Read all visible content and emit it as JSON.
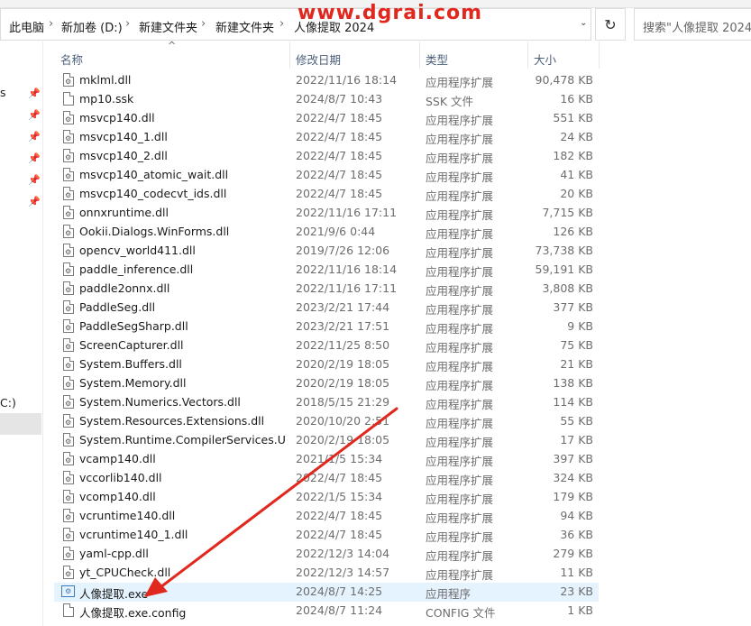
{
  "address_bar": {
    "crumbs": [
      "此电脑",
      "新加卷 (D:)",
      "新建文件夹",
      "新建文件夹",
      "人像提取 2024"
    ],
    "refresh_icon": "refresh-icon"
  },
  "search": {
    "placeholder": "搜索\"人像提取 2024\""
  },
  "watermark": "www.dgrai.com",
  "nav": {
    "partial_label_1": "s",
    "partial_label_2": "C:)"
  },
  "columns": {
    "name": "名称",
    "date": "修改日期",
    "type": "类型",
    "size": "大小"
  },
  "files": [
    {
      "name": "mklml.dll",
      "date": "2022/11/16 18:14",
      "type": "应用程序扩展",
      "size": "90,478 KB",
      "icon": "dll-file-icon"
    },
    {
      "name": "mp10.ssk",
      "date": "2024/8/7 10:43",
      "type": "SSK 文件",
      "size": "16 KB",
      "icon": "file-icon"
    },
    {
      "name": "msvcp140.dll",
      "date": "2022/4/7 18:45",
      "type": "应用程序扩展",
      "size": "551 KB",
      "icon": "dll-file-icon"
    },
    {
      "name": "msvcp140_1.dll",
      "date": "2022/4/7 18:45",
      "type": "应用程序扩展",
      "size": "24 KB",
      "icon": "dll-file-icon"
    },
    {
      "name": "msvcp140_2.dll",
      "date": "2022/4/7 18:45",
      "type": "应用程序扩展",
      "size": "182 KB",
      "icon": "dll-file-icon"
    },
    {
      "name": "msvcp140_atomic_wait.dll",
      "date": "2022/4/7 18:45",
      "type": "应用程序扩展",
      "size": "41 KB",
      "icon": "dll-file-icon"
    },
    {
      "name": "msvcp140_codecvt_ids.dll",
      "date": "2022/4/7 18:45",
      "type": "应用程序扩展",
      "size": "20 KB",
      "icon": "dll-file-icon"
    },
    {
      "name": "onnxruntime.dll",
      "date": "2022/11/16 17:11",
      "type": "应用程序扩展",
      "size": "7,715 KB",
      "icon": "dll-file-icon"
    },
    {
      "name": "Ookii.Dialogs.WinForms.dll",
      "date": "2021/9/6 0:44",
      "type": "应用程序扩展",
      "size": "126 KB",
      "icon": "dll-file-icon"
    },
    {
      "name": "opencv_world411.dll",
      "date": "2019/7/26 12:06",
      "type": "应用程序扩展",
      "size": "73,738 KB",
      "icon": "dll-file-icon"
    },
    {
      "name": "paddle_inference.dll",
      "date": "2022/11/16 18:14",
      "type": "应用程序扩展",
      "size": "59,191 KB",
      "icon": "dll-file-icon"
    },
    {
      "name": "paddle2onnx.dll",
      "date": "2022/11/16 17:11",
      "type": "应用程序扩展",
      "size": "3,808 KB",
      "icon": "dll-file-icon"
    },
    {
      "name": "PaddleSeg.dll",
      "date": "2023/2/21 17:44",
      "type": "应用程序扩展",
      "size": "377 KB",
      "icon": "dll-file-icon"
    },
    {
      "name": "PaddleSegSharp.dll",
      "date": "2023/2/21 17:51",
      "type": "应用程序扩展",
      "size": "9 KB",
      "icon": "dll-file-icon"
    },
    {
      "name": "ScreenCapturer.dll",
      "date": "2022/11/25 8:50",
      "type": "应用程序扩展",
      "size": "75 KB",
      "icon": "dll-file-icon"
    },
    {
      "name": "System.Buffers.dll",
      "date": "2020/2/19 18:05",
      "type": "应用程序扩展",
      "size": "21 KB",
      "icon": "dll-file-icon"
    },
    {
      "name": "System.Memory.dll",
      "date": "2020/2/19 18:05",
      "type": "应用程序扩展",
      "size": "138 KB",
      "icon": "dll-file-icon"
    },
    {
      "name": "System.Numerics.Vectors.dll",
      "date": "2018/5/15 21:29",
      "type": "应用程序扩展",
      "size": "114 KB",
      "icon": "dll-file-icon"
    },
    {
      "name": "System.Resources.Extensions.dll",
      "date": "2020/10/20 2:51",
      "type": "应用程序扩展",
      "size": "55 KB",
      "icon": "dll-file-icon"
    },
    {
      "name": "System.Runtime.CompilerServices.Un...",
      "date": "2020/2/19 18:05",
      "type": "应用程序扩展",
      "size": "17 KB",
      "icon": "dll-file-icon"
    },
    {
      "name": "vcamp140.dll",
      "date": "2021/1/5 15:34",
      "type": "应用程序扩展",
      "size": "397 KB",
      "icon": "dll-file-icon"
    },
    {
      "name": "vccorlib140.dll",
      "date": "2022/4/7 18:45",
      "type": "应用程序扩展",
      "size": "324 KB",
      "icon": "dll-file-icon"
    },
    {
      "name": "vcomp140.dll",
      "date": "2022/1/5 15:34",
      "type": "应用程序扩展",
      "size": "179 KB",
      "icon": "dll-file-icon"
    },
    {
      "name": "vcruntime140.dll",
      "date": "2022/4/7 18:45",
      "type": "应用程序扩展",
      "size": "94 KB",
      "icon": "dll-file-icon"
    },
    {
      "name": "vcruntime140_1.dll",
      "date": "2022/4/7 18:45",
      "type": "应用程序扩展",
      "size": "36 KB",
      "icon": "dll-file-icon"
    },
    {
      "name": "yaml-cpp.dll",
      "date": "2022/12/3 14:04",
      "type": "应用程序扩展",
      "size": "279 KB",
      "icon": "dll-file-icon"
    },
    {
      "name": "yt_CPUCheck.dll",
      "date": "2022/12/3 14:57",
      "type": "应用程序扩展",
      "size": "11 KB",
      "icon": "dll-file-icon"
    },
    {
      "name": "人像提取.exe",
      "date": "2024/8/7 14:25",
      "type": "应用程序",
      "size": "23 KB",
      "icon": "exe-app-icon",
      "selected": true
    },
    {
      "name": "人像提取.exe.config",
      "date": "2024/8/7 11:24",
      "type": "CONFIG 文件",
      "size": "1 KB",
      "icon": "file-icon"
    }
  ],
  "annotation_color": "#e0281e"
}
